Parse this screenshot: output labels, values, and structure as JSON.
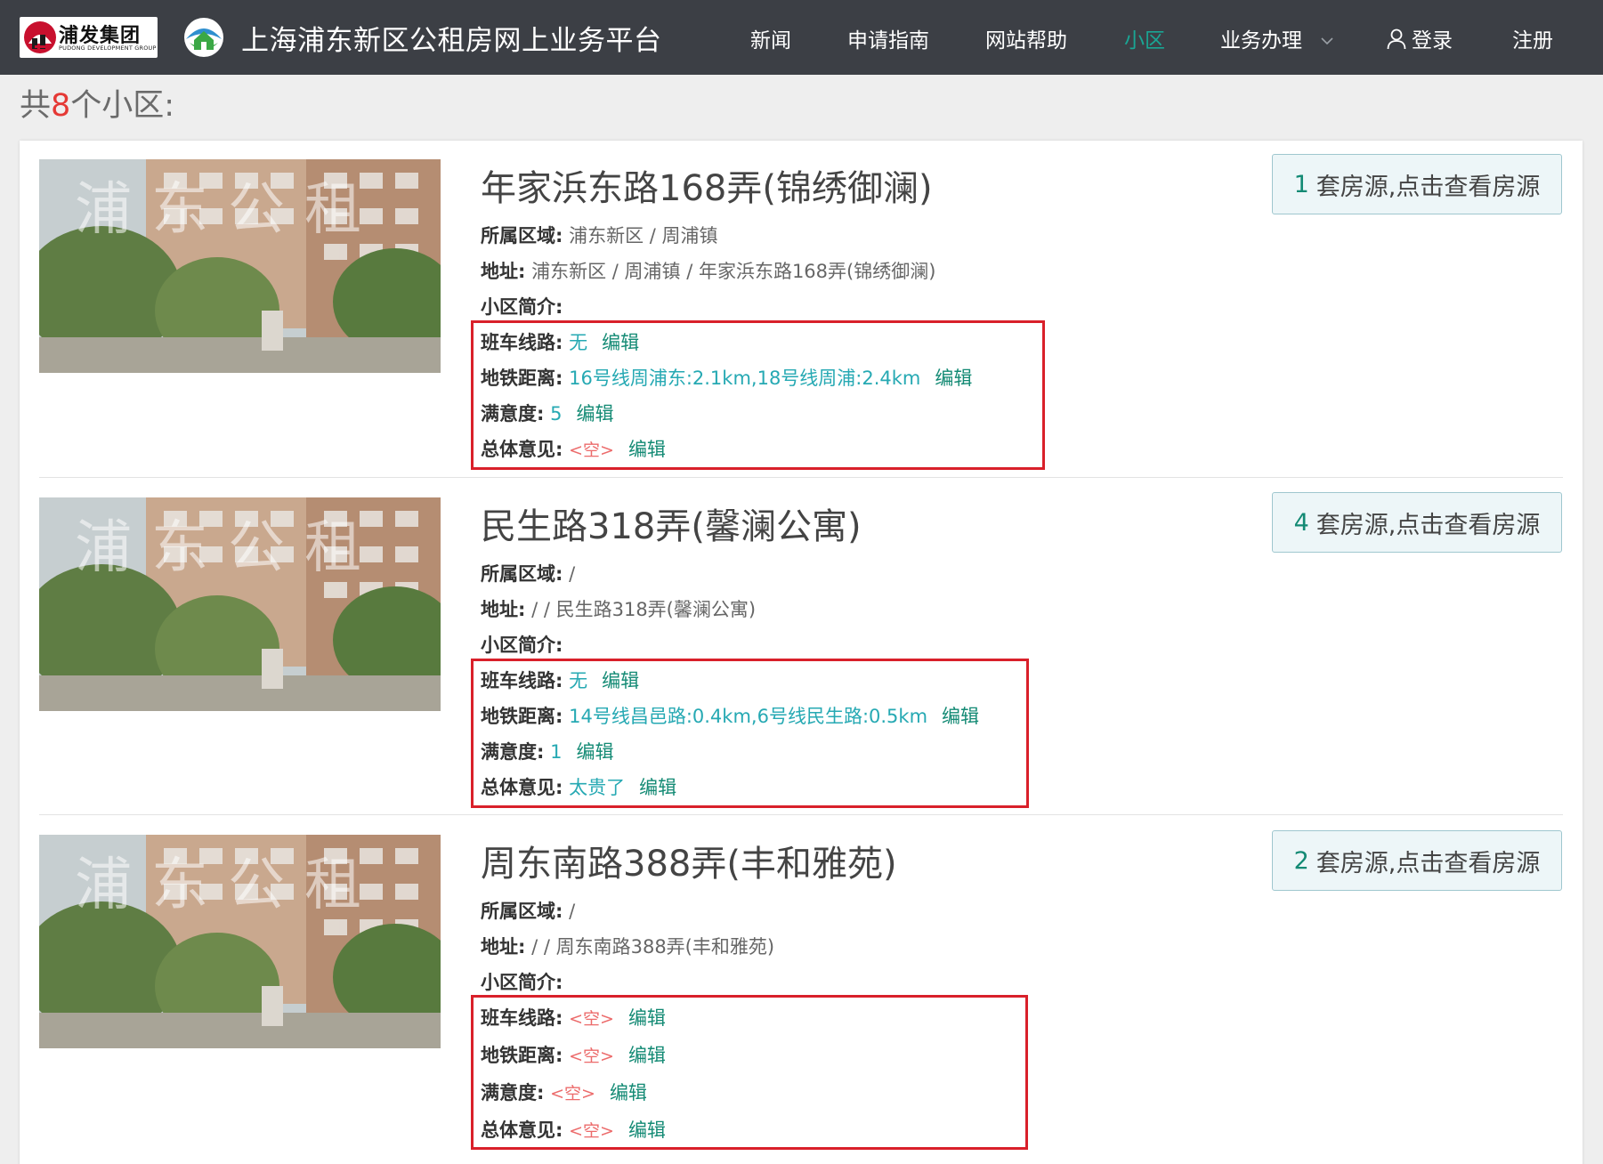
{
  "header": {
    "logo_cn": "浦发集团",
    "logo_en": "PUDONG DEVELOPMENT GROUP",
    "site_title": "上海浦东新区公租房网上业务平台",
    "nav": [
      {
        "label": "新闻"
      },
      {
        "label": "申请指南"
      },
      {
        "label": "网站帮助"
      },
      {
        "label": "小区"
      },
      {
        "label": "业务办理"
      },
      {
        "label": "登录"
      },
      {
        "label": "注册"
      }
    ]
  },
  "count": {
    "prefix": "共",
    "number": "8",
    "suffix": "个小区:"
  },
  "colors": {
    "accent": "#1aa594",
    "highlight_border": "#d9202a",
    "teal_text": "#26a9b3",
    "empty_text": "#ec6b6b"
  },
  "labels": {
    "region": "所属区域:",
    "address": "地址:",
    "intro": "小区简介:",
    "shuttle": "班车线路:",
    "metro": "地铁距离:",
    "satisfaction": "满意度:",
    "opinion": "总体意见:",
    "edit": "编辑",
    "empty": "<空>",
    "house_suffix": "套房源,点击查看房源"
  },
  "image_watermark": "浦东公租",
  "communities": [
    {
      "name": "年家浜东路168弄(锦绣御澜)",
      "region": "浦东新区 / 周浦镇",
      "address": "浦东新区 / 周浦镇 / 年家浜东路168弄(锦绣御澜)",
      "intro": "",
      "shuttle": "无",
      "metro": "16号线周浦东:2.1km,18号线周浦:2.4km",
      "satisfaction": "5",
      "opinion": "",
      "house_count": "1"
    },
    {
      "name": "民生路318弄(馨澜公寓)",
      "region": "/",
      "address": "/ / 民生路318弄(馨澜公寓)",
      "intro": "",
      "shuttle": "无",
      "metro": "14号线昌邑路:0.4km,6号线民生路:0.5km",
      "satisfaction": "1",
      "opinion": "太贵了",
      "house_count": "4"
    },
    {
      "name": "周东南路388弄(丰和雅苑)",
      "region": "/",
      "address": "/ / 周东南路388弄(丰和雅苑)",
      "intro": "",
      "shuttle": "",
      "metro": "",
      "satisfaction": "",
      "opinion": "",
      "house_count": "2"
    }
  ]
}
